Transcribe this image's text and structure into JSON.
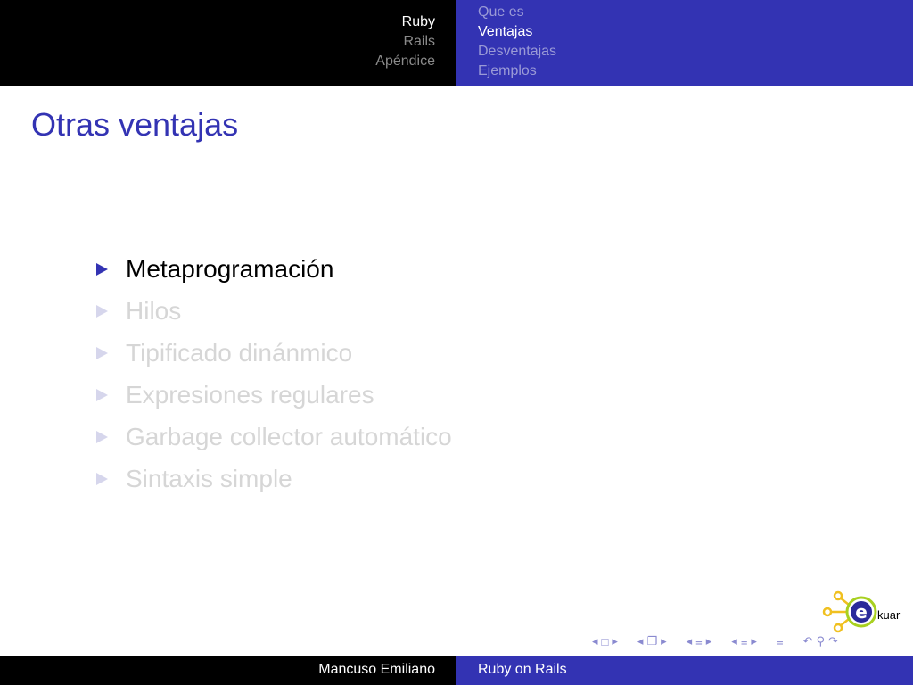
{
  "header": {
    "sections": [
      {
        "label": "Ruby",
        "active": true
      },
      {
        "label": "Rails",
        "active": false
      },
      {
        "label": "Apéndice",
        "active": false
      }
    ],
    "subsections": [
      {
        "label": "Que es",
        "active": false
      },
      {
        "label": "Ventajas",
        "active": true
      },
      {
        "label": "Desventajas",
        "active": false
      },
      {
        "label": "Ejemplos",
        "active": false
      }
    ]
  },
  "frame": {
    "title": "Otras ventajas",
    "bullets": [
      "Metaprogramación",
      "Hilos",
      "Tipificado dinánmico",
      "Expresiones regulares",
      "Garbage collector automático",
      "Sintaxis simple"
    ],
    "active_bullet_index": 0
  },
  "logo": {
    "text": "kuar"
  },
  "footer": {
    "author": "Mancuso Emiliano",
    "title": "Ruby on Rails"
  },
  "colors": {
    "accent": "#3333b3",
    "header_dark": "#000000",
    "inactive_text": "#d6d6d6"
  }
}
